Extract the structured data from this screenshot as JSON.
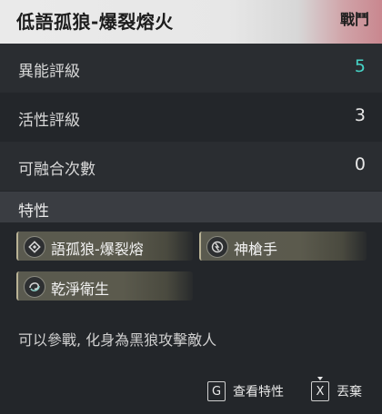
{
  "header": {
    "title": "低語孤狼-爆裂熔火",
    "tag": "戰鬥"
  },
  "stats": [
    {
      "label": "異能評級",
      "value": "5"
    },
    {
      "label": "活性評級",
      "value": "3"
    },
    {
      "label": "可融合次數",
      "value": "0"
    }
  ],
  "traits": {
    "section_label": "特性",
    "items": [
      {
        "label": "語孤狼-爆裂熔",
        "icon": "diamond-icon"
      },
      {
        "label": "神槍手",
        "icon": "crosshair-icon"
      },
      {
        "label": "乾淨衛生",
        "icon": "swirl-icon"
      }
    ]
  },
  "description": "可以參戰, 化身為黑狼攻擊敵人",
  "footer": {
    "view_key": "G",
    "view_label": "查看特性",
    "discard_key": "X",
    "discard_label": "丟棄"
  },
  "colors": {
    "accent": "#46d4c7"
  }
}
